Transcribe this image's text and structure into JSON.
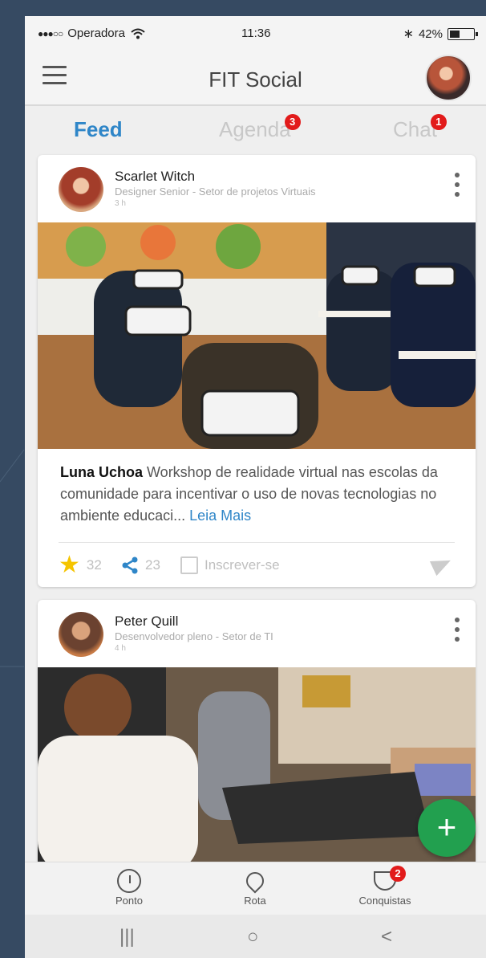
{
  "status_bar": {
    "signal": "●●●○○",
    "carrier": "Operadora",
    "time": "11:36",
    "battery": "42%",
    "bluetooth_icon": "bluetooth-icon",
    "wifi_icon": "wifi-icon"
  },
  "header": {
    "title": "FIT Social"
  },
  "tabs": [
    {
      "label": "Feed",
      "badge": ""
    },
    {
      "label": "Agenda",
      "badge": "3"
    },
    {
      "label": "Chat",
      "badge": "1"
    }
  ],
  "posts": [
    {
      "author": "Scarlet Witch",
      "role": "Designer Senior - Setor de projetos Virtuais",
      "time": "3 h",
      "text_author": "Luna Uchoa",
      "text": " Workshop de realidade virtual nas escolas da comunidade para incentivar o uso de novas tecnologias no ambiente educaci...",
      "read_more": "Leia Mais",
      "likes": "32",
      "shares": "23",
      "subscribe_label": "Inscrever-se"
    },
    {
      "author": "Peter Quill",
      "role": "Desenvolvedor pleno - Setor de TI",
      "time": "4 h"
    }
  ],
  "fab": {
    "label": "+"
  },
  "bottom_nav": [
    {
      "label": "Ponto",
      "icon": "clock-icon"
    },
    {
      "label": "Rota",
      "icon": "pin-icon"
    },
    {
      "label": "Conquistas",
      "icon": "trophy-icon",
      "badge": "2"
    }
  ],
  "system_nav": {
    "recents": "|||",
    "home": "○",
    "back": "<"
  },
  "colors": {
    "accent": "#2f86c8",
    "badge": "#e21b1b",
    "fab": "#22a04f",
    "star": "#f5c400"
  }
}
